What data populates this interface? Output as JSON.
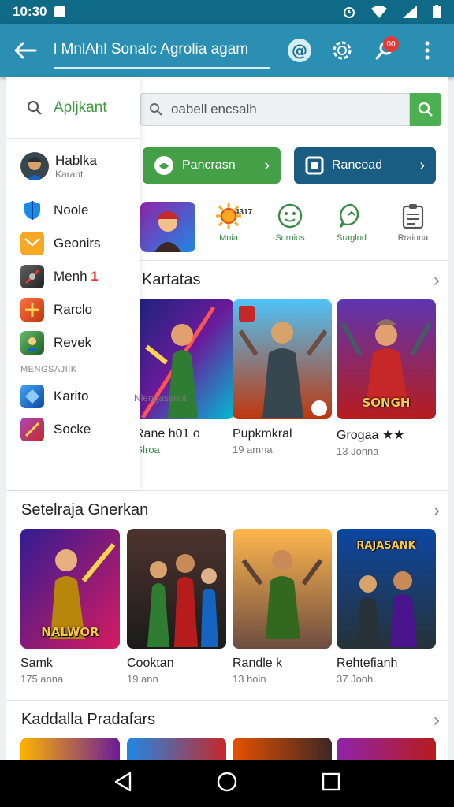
{
  "status_bar": {
    "time": "10:30"
  },
  "app_bar": {
    "title": "l MnlAhl Sonalc Agrolia agam"
  },
  "notifications": {
    "badge": "00"
  },
  "search": {
    "placeholder": "oabell encsalh"
  },
  "drawer": {
    "search_label": "Apljkant",
    "user": {
      "name": "Hablka",
      "sub": "Karant"
    },
    "items": [
      {
        "label": "Noole",
        "icon": "shield-icon",
        "color": "#1e88e5"
      },
      {
        "label": "Geonirs",
        "icon": "envelope-icon",
        "color": "#f9a825"
      },
      {
        "label": "Menh",
        "badge": "1",
        "icon": "game-art-icon",
        "color": "#424242"
      },
      {
        "label": "Rarclo",
        "icon": "game-art-icon",
        "color": "#e65100"
      },
      {
        "label": "Revek",
        "icon": "game-art-icon",
        "color": "#2e7d32"
      }
    ],
    "subheader": "MENGSAJIIK",
    "items2": [
      {
        "label": "Karito",
        "icon": "game-art-icon",
        "color": "#1565c0"
      },
      {
        "label": "Socke",
        "icon": "game-art-icon",
        "color": "#6a1b9a"
      }
    ],
    "footer": "Nlengassnot"
  },
  "promo": {
    "green_label": "Pancrasn",
    "blue_label": "Rancoad"
  },
  "categories": {
    "number": "4317",
    "items": [
      {
        "label": "Mnia",
        "icon": "sun-icon"
      },
      {
        "label": "Sornios",
        "icon": "smiley-icon"
      },
      {
        "label": "Sraglod",
        "icon": "chat-icon"
      },
      {
        "label": "Rrainna",
        "icon": "clipboard-icon"
      }
    ]
  },
  "sections": [
    {
      "title": "Kartatas",
      "cards": [
        {
          "name": "Rane h01 o",
          "meta": "Glroa",
          "caption": ""
        },
        {
          "name": "Pupkmkral",
          "meta": "19 amna",
          "caption": ""
        },
        {
          "name": "Grogaa ★★",
          "meta": "13 Jonna",
          "caption": "SONGH"
        }
      ]
    },
    {
      "title": "Setelraja Gnerkan",
      "cards": [
        {
          "name": "Samk",
          "meta": "175 anna",
          "caption": "NALWOR"
        },
        {
          "name": "Cooktan",
          "meta": "19 ann",
          "caption": ""
        },
        {
          "name": "Randle k",
          "meta": "13 hoin",
          "caption": ""
        },
        {
          "name": "Rehtefianh",
          "meta": "37 Jooh",
          "caption": "RAJASANK"
        }
      ]
    },
    {
      "title": "Kaddalla Pradafars"
    }
  ]
}
